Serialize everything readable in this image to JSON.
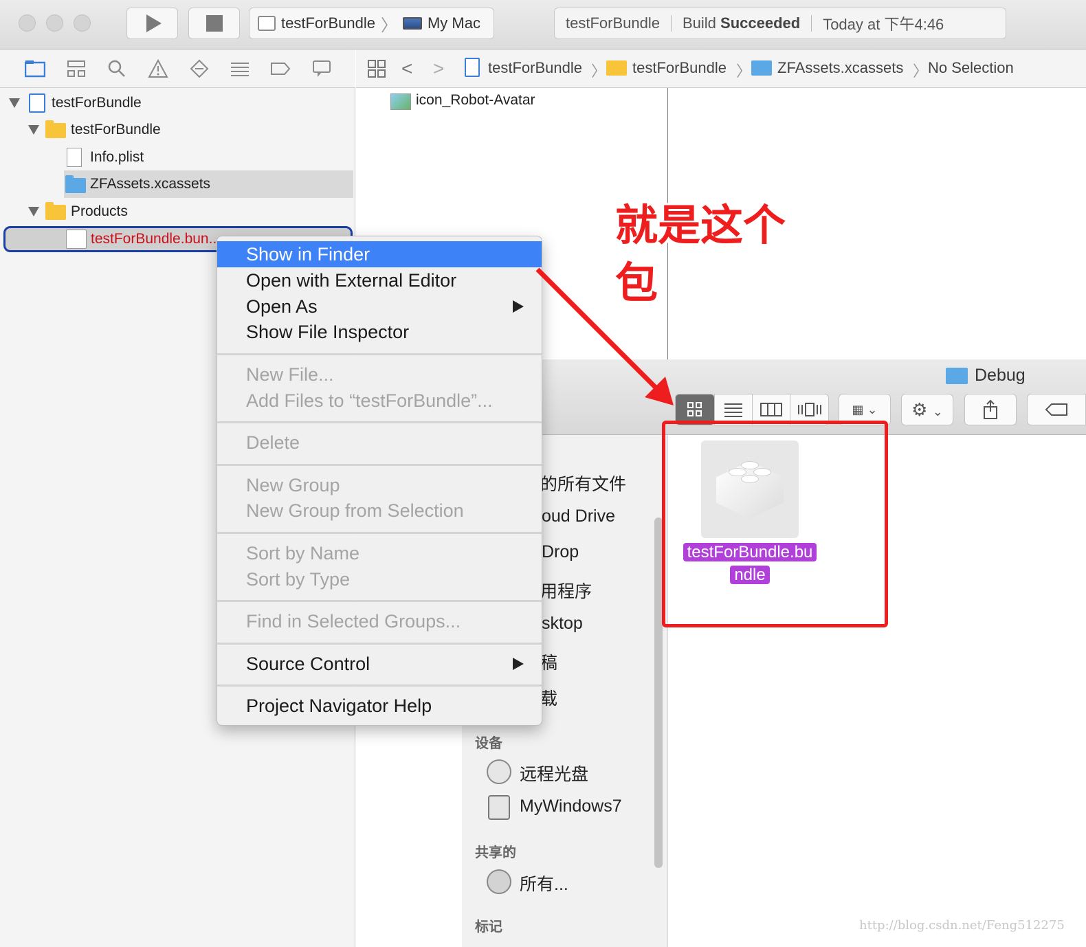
{
  "toolbar": {
    "scheme_name": "testForBundle",
    "destination": "My Mac",
    "status_project": "testForBundle",
    "status_build_prefix": "Build ",
    "status_build_bold": "Succeeded",
    "status_time": "Today at 下午4:46"
  },
  "navigator_tabs": [
    "project-navigator-icon",
    "symbol-navigator-icon",
    "find-navigator-icon",
    "issue-navigator-icon",
    "test-navigator-icon",
    "debug-navigator-icon",
    "breakpoint-navigator-icon",
    "report-navigator-icon"
  ],
  "tree": {
    "root": "testForBundle",
    "group": "testForBundle",
    "info_plist": "Info.plist",
    "assets": "ZFAssets.xcassets",
    "products": "Products",
    "bundle": "testForBundle.bun..."
  },
  "jumpbar": {
    "crumb1": "testForBundle",
    "crumb2": "testForBundle",
    "crumb3": "ZFAssets.xcassets",
    "crumb4": "No Selection"
  },
  "asset_list": {
    "item": "icon_Robot-Avatar"
  },
  "context_menu": {
    "show_in_finder": "Show in Finder",
    "open_external": "Open with External Editor",
    "open_as": "Open As",
    "show_inspector": "Show File Inspector",
    "new_file": "New File...",
    "add_files": "Add Files to “testForBundle”...",
    "delete": "Delete",
    "new_group": "New Group",
    "new_group_sel": "New Group from Selection",
    "sort_name": "Sort by Name",
    "sort_type": "Sort by Type",
    "find_groups": "Find in Selected Groups...",
    "source_control": "Source Control",
    "help": "Project Navigator Help"
  },
  "finder": {
    "title": "Debug",
    "sidebar": {
      "all_files": "的所有文件",
      "icloud": "oud Drive",
      "airdrop": "Drop",
      "apps": "用程序",
      "desktop": "sktop",
      "docs": "稿",
      "downloads": "载",
      "devices_header": "设备",
      "remote_disc": "远程光盘",
      "mywin": "MyWindows7",
      "shared_header": "共享的",
      "shared_all": "所有...",
      "tags_header": "标记"
    },
    "file_line1": "testForBundle.bu",
    "file_line2": "ndle"
  },
  "annotation": {
    "line1": "就是这个",
    "line2": "包",
    "color": "#ee1e1e"
  },
  "watermark": "http://blog.csdn.net/Feng512275",
  "colors": {
    "highlight": "#3e82f7",
    "selection_purple": "#b040d9",
    "product_red": "#c9101a"
  }
}
